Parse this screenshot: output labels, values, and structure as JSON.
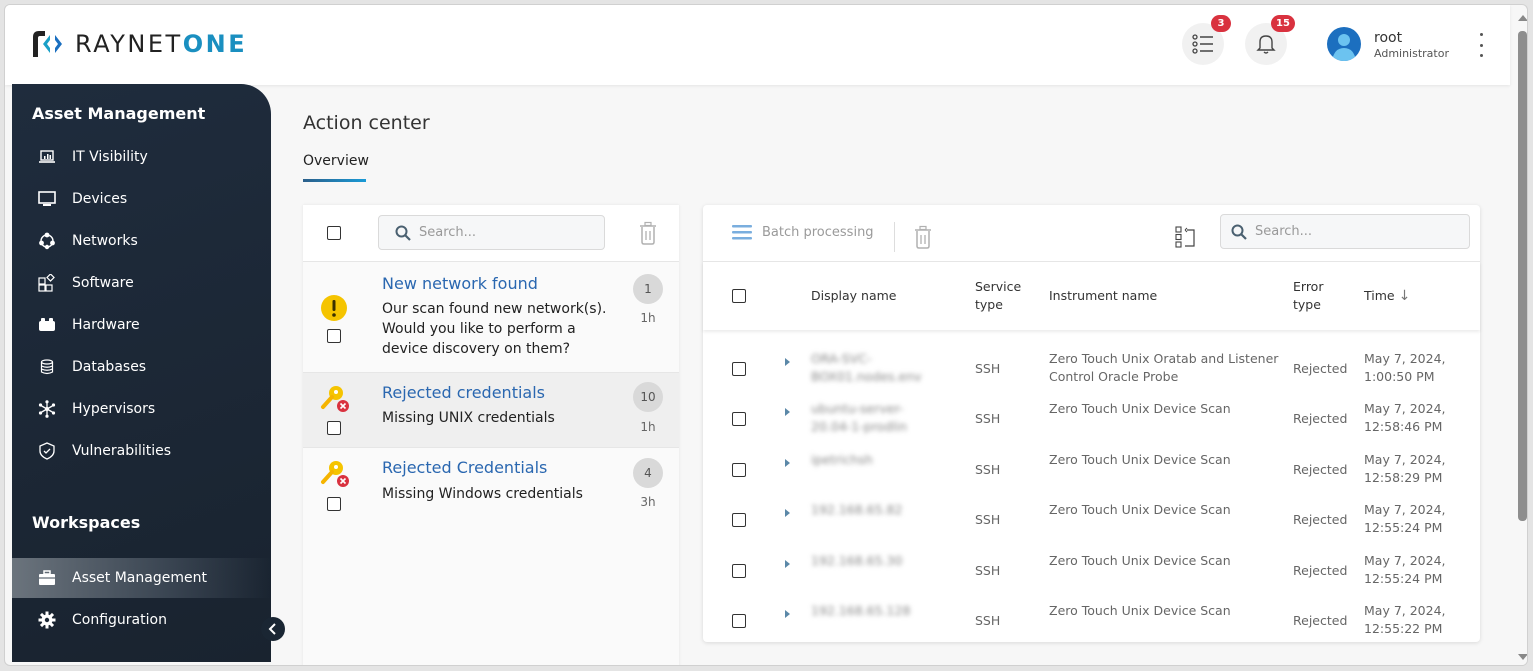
{
  "header": {
    "logo_main": "RAYNET",
    "logo_accent": "ONE",
    "tasks_icon": "list-icon",
    "tasks_badge": "3",
    "notifications_icon": "bell-icon",
    "notifications_badge": "15",
    "user_name": "root",
    "user_role": "Administrator",
    "menu_icon": "kebab-menu-icon"
  },
  "sidebar": {
    "section1": "Asset Management",
    "items": [
      {
        "label": "IT Visibility",
        "icon": "laptop-chart-icon"
      },
      {
        "label": "Devices",
        "icon": "monitor-icon"
      },
      {
        "label": "Networks",
        "icon": "network-icon"
      },
      {
        "label": "Software",
        "icon": "apps-icon"
      },
      {
        "label": "Hardware",
        "icon": "hardware-icon"
      },
      {
        "label": "Databases",
        "icon": "database-icon"
      },
      {
        "label": "Hypervisors",
        "icon": "hypervisor-icon"
      },
      {
        "label": "Vulnerabilities",
        "icon": "shield-icon"
      }
    ],
    "section2": "Workspaces",
    "workspaces": [
      {
        "label": "Asset Management",
        "icon": "briefcase-icon",
        "active": true
      },
      {
        "label": "Configuration",
        "icon": "gear-icon",
        "active": false
      }
    ]
  },
  "page": {
    "title": "Action center",
    "tabs": [
      {
        "label": "Overview",
        "active": true
      }
    ]
  },
  "messages_panel": {
    "search_placeholder": "Search...",
    "items": [
      {
        "title": "New network found",
        "body": "Our scan found new network(s). Would you like to perform a device discovery on them?",
        "count": "1",
        "age": "1h",
        "icon": "warning-icon",
        "selected": false
      },
      {
        "title": "Rejected credentials",
        "body": "Missing UNIX credentials",
        "count": "10",
        "age": "1h",
        "icon": "key-rejected-icon",
        "selected": true
      },
      {
        "title": "Rejected Credentials",
        "body": "Missing Windows credentials",
        "count": "4",
        "age": "3h",
        "icon": "key-rejected-icon",
        "selected": false
      }
    ]
  },
  "details_panel": {
    "batch_label": "Batch processing",
    "search_placeholder": "Search...",
    "columns": [
      "Display name",
      "Service type",
      "Instrument name",
      "Error type",
      "Time"
    ],
    "sort_indicator": "↓",
    "rows": [
      {
        "display_name": "ORA-SVC-BOX01.nodes.env",
        "service": "SSH",
        "instrument": "Zero Touch Unix Oratab and Listener Control Oracle Probe",
        "error": "Rejected",
        "time_date": "May 7, 2024,",
        "time_clock": "1:00:50 PM"
      },
      {
        "display_name": "ubuntu-server-20.04-1-prodlin",
        "service": "SSH",
        "instrument": "Zero Touch Unix Device Scan",
        "error": "Rejected",
        "time_date": "May 7, 2024,",
        "time_clock": "12:58:46 PM"
      },
      {
        "display_name": "ipetrichsh",
        "service": "SSH",
        "instrument": "Zero Touch Unix Device Scan",
        "error": "Rejected",
        "time_date": "May 7, 2024,",
        "time_clock": "12:58:29 PM"
      },
      {
        "display_name": "192.168.65.82",
        "service": "SSH",
        "instrument": "Zero Touch Unix Device Scan",
        "error": "Rejected",
        "time_date": "May 7, 2024,",
        "time_clock": "12:55:24 PM"
      },
      {
        "display_name": "192.168.65.30",
        "service": "SSH",
        "instrument": "Zero Touch Unix Device Scan",
        "error": "Rejected",
        "time_date": "May 7, 2024,",
        "time_clock": "12:55:24 PM"
      },
      {
        "display_name": "192.168.65.128",
        "service": "SSH",
        "instrument": "Zero Touch Unix Device Scan",
        "error": "Rejected",
        "time_date": "May 7, 2024,",
        "time_clock": "12:55:22 PM"
      }
    ]
  },
  "colors": {
    "sidebar_bg": "#1f2c3d",
    "accent": "#1a8fc0",
    "link": "#2a67b0",
    "badge": "#d9323f",
    "warning": "#f5c400"
  }
}
